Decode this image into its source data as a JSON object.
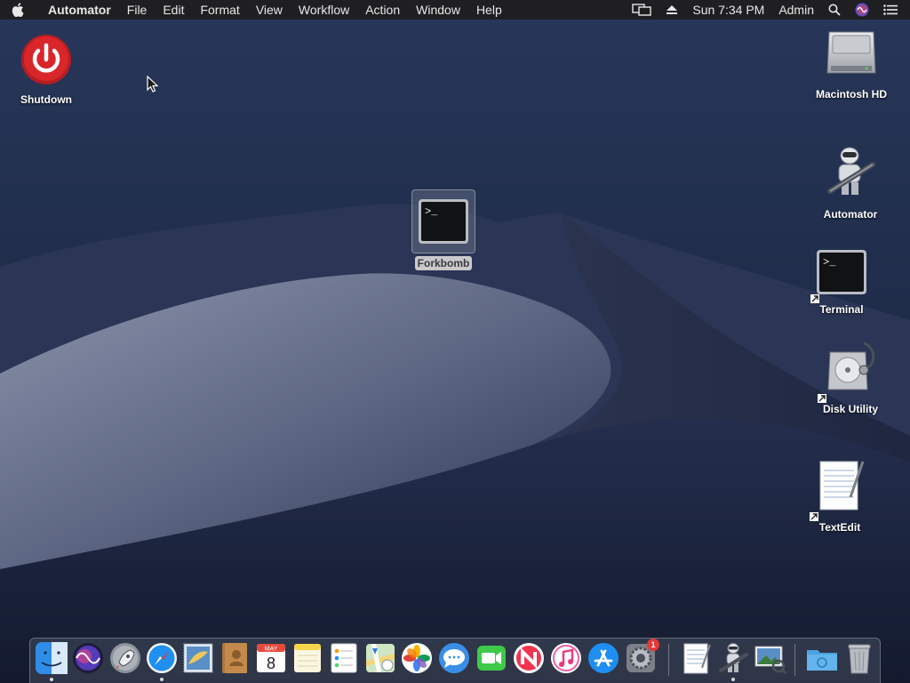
{
  "menubar": {
    "app_name": "Automator",
    "menus": [
      "File",
      "Edit",
      "Format",
      "View",
      "Workflow",
      "Action",
      "Window",
      "Help"
    ],
    "clock": "Sun 7:34 PM",
    "user": "Admin",
    "status_icons": [
      "screen-mirroring-icon",
      "eject-icon",
      "spotlight-icon",
      "siri-icon",
      "notification-center-icon"
    ]
  },
  "desktop": {
    "icons": {
      "shutdown": "Shutdown",
      "forkbomb": "Forkbomb",
      "macintosh_hd": "Macintosh HD",
      "automator": "Automator",
      "terminal": "Terminal",
      "disk_utility": "Disk Utility",
      "textedit": "TextEdit"
    },
    "terminal_prompt": ">_"
  },
  "dock": {
    "apps": [
      "Finder",
      "Siri",
      "Launchpad",
      "Safari",
      "Mail",
      "Contacts",
      "Calendar",
      "Notes",
      "Reminders",
      "Maps",
      "Photos",
      "Messages",
      "FaceTime",
      "News",
      "iTunes",
      "App Store",
      "System Preferences",
      "TextEdit",
      "Automator",
      "Preview",
      "Downloads",
      "Trash"
    ],
    "calendar_month": "MAY",
    "calendar_day": "8",
    "system_preferences_badge": "1"
  },
  "colors": {
    "menubar_bg": "#1f1f22",
    "wallpaper_sky": "#1b2742",
    "shutdown_red": "#d9262b",
    "badge_red": "#e53935"
  }
}
